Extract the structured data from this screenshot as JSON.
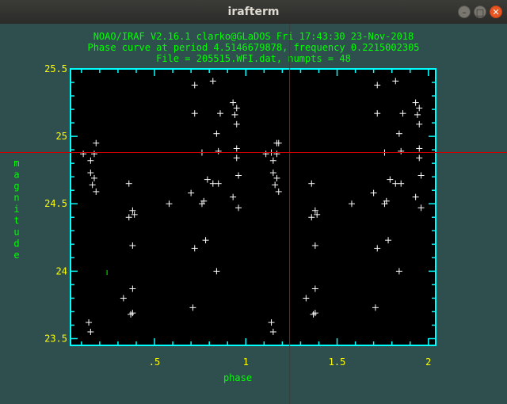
{
  "window": {
    "title": "irafterm",
    "minimize_glyph": "–",
    "maximize_glyph": "□",
    "close_glyph": "✕"
  },
  "header": {
    "line1": "NOAO/IRAF V2.16.1 clarko@GLaDOS Fri 17:43:30 23-Nov-2018",
    "line2": "Phase curve at period 4.5146679878, frequency 0.2215002305",
    "line3": "File = 205515.WFI.dat, numpts = 48"
  },
  "colors": {
    "terminal_bg": "#2f4f4f",
    "plot_bg": "#000000",
    "frame": "#00ffff",
    "header_text": "#00ff00",
    "tick_labels": "#ffff00",
    "axis_labels": "#00ff00",
    "points": "#ffffff",
    "cursor": "#cc0000"
  },
  "chart_data": {
    "type": "scatter",
    "marker": "plus",
    "xlabel": "phase",
    "ylabel": "magnitude",
    "xlim": [
      0.04,
      2.04
    ],
    "ylim": [
      23.45,
      25.5
    ],
    "yaxis_inverted": false,
    "grid": false,
    "x_tick_labels": [
      ".5",
      "1",
      "1.5",
      "2"
    ],
    "x_ticks": [
      0.5,
      1.0,
      1.5,
      2.0
    ],
    "y_tick_labels": [
      "23.5",
      "24",
      "24.5",
      "25",
      "25.5"
    ],
    "y_ticks": [
      23.5,
      24.0,
      24.5,
      25.0,
      25.5
    ],
    "cursor": {
      "x": 1.24,
      "y": 24.88
    },
    "extra_mark": {
      "x": 0.24,
      "y": 23.99
    },
    "points": [
      {
        "x": 0.14,
        "y": 23.62
      },
      {
        "x": 0.15,
        "y": 23.55
      },
      {
        "x": 0.33,
        "y": 23.8
      },
      {
        "x": 0.37,
        "y": 23.68
      },
      {
        "x": 0.38,
        "y": 23.69
      },
      {
        "x": 0.38,
        "y": 23.87
      },
      {
        "x": 0.38,
        "y": 24.19
      },
      {
        "x": 0.71,
        "y": 23.73
      },
      {
        "x": 0.84,
        "y": 24.0
      },
      {
        "x": 0.72,
        "y": 24.17
      },
      {
        "x": 0.78,
        "y": 24.23
      },
      {
        "x": 0.36,
        "y": 24.4
      },
      {
        "x": 0.38,
        "y": 24.45
      },
      {
        "x": 0.39,
        "y": 24.42
      },
      {
        "x": 0.58,
        "y": 24.5
      },
      {
        "x": 0.76,
        "y": 24.5
      },
      {
        "x": 0.77,
        "y": 24.52
      },
      {
        "x": 0.93,
        "y": 24.55
      },
      {
        "x": 0.96,
        "y": 24.47
      },
      {
        "x": 0.7,
        "y": 24.58
      },
      {
        "x": 0.18,
        "y": 24.59
      },
      {
        "x": 0.36,
        "y": 24.65
      },
      {
        "x": 0.16,
        "y": 24.64
      },
      {
        "x": 0.17,
        "y": 24.69
      },
      {
        "x": 0.15,
        "y": 24.73
      },
      {
        "x": 0.79,
        "y": 24.68
      },
      {
        "x": 0.82,
        "y": 24.65
      },
      {
        "x": 0.85,
        "y": 24.65
      },
      {
        "x": 0.96,
        "y": 24.71
      },
      {
        "x": 0.15,
        "y": 24.82
      },
      {
        "x": 0.17,
        "y": 24.87
      },
      {
        "x": 0.11,
        "y": 24.87
      },
      {
        "x": 0.18,
        "y": 24.95
      },
      {
        "x": 0.76,
        "y": 24.88
      },
      {
        "x": 0.85,
        "y": 24.89
      },
      {
        "x": 0.95,
        "y": 24.91
      },
      {
        "x": 0.95,
        "y": 24.84
      },
      {
        "x": 0.84,
        "y": 25.02
      },
      {
        "x": 0.95,
        "y": 25.09
      },
      {
        "x": 0.72,
        "y": 25.17
      },
      {
        "x": 0.86,
        "y": 25.17
      },
      {
        "x": 0.94,
        "y": 25.16
      },
      {
        "x": 0.95,
        "y": 25.21
      },
      {
        "x": 0.93,
        "y": 25.25
      },
      {
        "x": 0.72,
        "y": 25.38
      },
      {
        "x": 0.82,
        "y": 25.41
      },
      {
        "x": 1.14,
        "y": 24.88
      },
      {
        "x": 1.17,
        "y": 24.95
      }
    ]
  }
}
